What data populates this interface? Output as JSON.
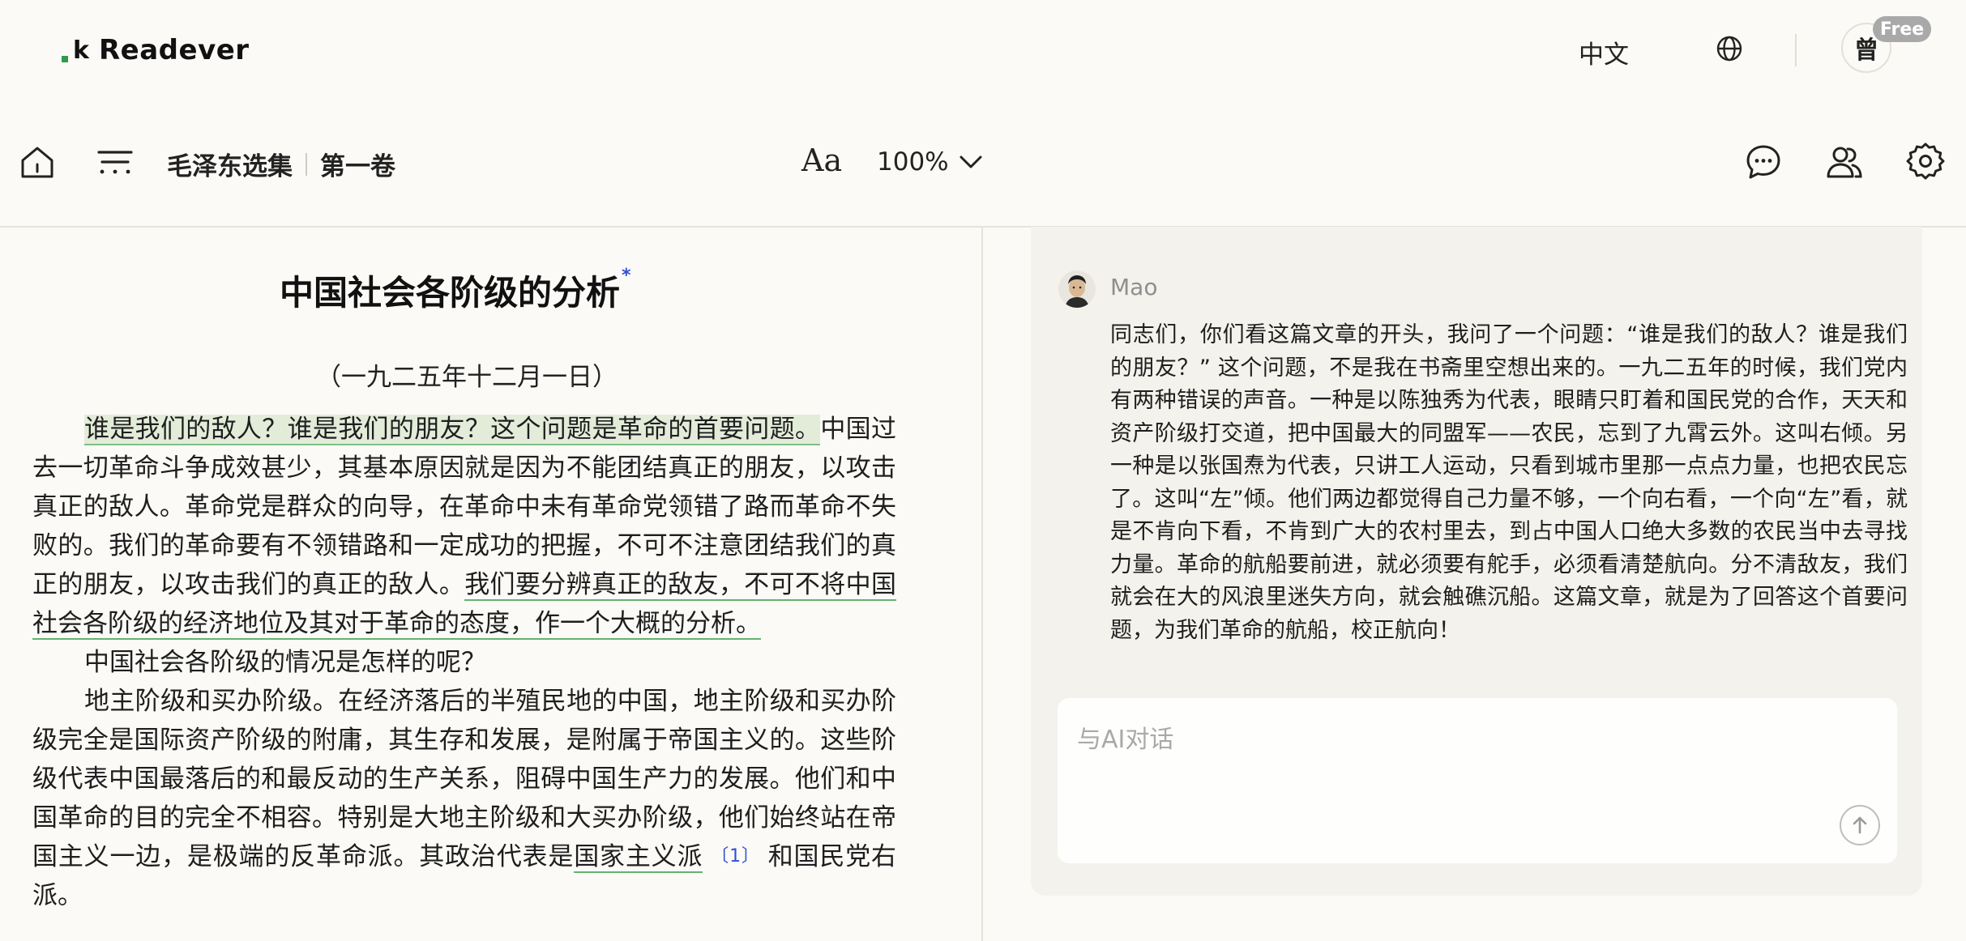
{
  "header": {
    "logo_text": "Readever",
    "language_label": "中文",
    "avatar_initial": "曾",
    "plan_badge": "Free"
  },
  "toolbar": {
    "book_title": "毛泽东选集",
    "volume": "第一卷",
    "font_button_label": "Aa",
    "zoom_level": "100%"
  },
  "article": {
    "title": "中国社会各阶级的分析",
    "title_mark": "*",
    "date": "（一九二五年十二月一日）",
    "p1": {
      "highlight": "谁是我们的敌人？谁是我们的朋友？这个问题是革命的首要问题。",
      "text1": "中国过去一切革命斗争成效甚少，其基本原因就是因为不能团结真正的朋友，以攻击真正的敌人。革命党是群众的向导，在革命中未有革命党领错了路而革命不失败的。我们的革命要有不领错路和一定成功的把握，不可不注意团结我们的真正的朋友，以攻击我们的真正的敌人。",
      "underline": "我们要分辨真正的敌友，不可不将中国社会各阶级的经济地位及其对于革命的态度，作一个大概的分析。"
    },
    "p2": "中国社会各阶级的情况是怎样的呢？",
    "p3": {
      "text1": "地主阶级和买办阶级。在经济落后的半殖民地的中国，地主阶级和买办阶级完全是国际资产阶级的附庸，其生存和发展，是附属于帝国主义的。这些阶级代表中国最落后的和最反动的生产关系，阻碍中国生产力的发展。他们和中国革命的目的完全不相容。特别是大地主阶级和大买办阶级，他们始终站在帝国主义一边，是极端的反革命派。其政治代表是",
      "link": "国家主义派",
      "note": "〔1〕",
      "text2": "和国民党右派。"
    }
  },
  "chat": {
    "bot_name": "Mao",
    "message": "同志们，你们看这篇文章的开头，我问了一个问题：“谁是我们的敌人？谁是我们的朋友？” 这个问题，不是我在书斋里空想出来的。一九二五年的时候，我们党内有两种错误的声音。一种是以陈独秀为代表，眼睛只盯着和国民党的合作，天天和资产阶级打交道，把中国最大的同盟军——农民，忘到了九霄云外。这叫右倾。另一种是以张国焘为代表，只讲工人运动，只看到城市里那一点点力量，也把农民忘了。这叫“左”倾。他们两边都觉得自己力量不够，一个向右看，一个向“左”看，就是不肯向下看，不肯到广大的农村里去，到占中国人口绝大多数的农民当中去寻找力量。革命的航船要前进，就必须要有舵手，必须看清楚航向。分不清敌友，我们就会在大的风浪里迷失方向，就会触礁沉船。这篇文章，就是为了回答这个首要问题，为我们革命的航船，校正航向！",
    "input_placeholder": "与AI对话"
  },
  "icons": [
    "home-icon",
    "table-of-contents-icon",
    "chevron-down-icon",
    "globe-icon",
    "chat-bubble-icon",
    "users-icon",
    "settings-gear-icon",
    "send-arrow-icon"
  ],
  "colors": {
    "background": "#fbfaf6",
    "highlight": "#e3ecd9",
    "underline": "#63b36f",
    "link": "#2d4fd6",
    "brand_green": "#2f9a4b",
    "badge": "#a9a9a9"
  }
}
